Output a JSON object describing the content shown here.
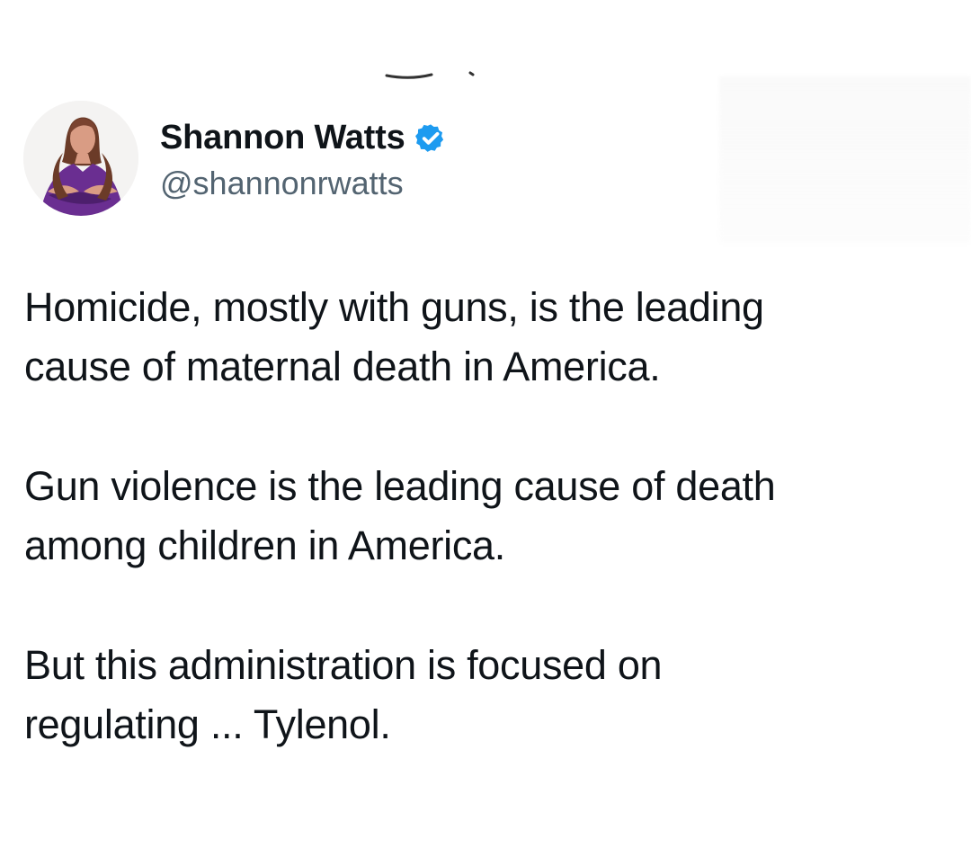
{
  "app": {
    "background_color": "#ffffff"
  },
  "tweet": {
    "author": {
      "name": "Shannon Watts",
      "handle": "@shannonrwatts",
      "verified": true,
      "avatar_icon": "profile-photo"
    },
    "paragraphs": [
      {
        "lines": [
          "Homicide, mostly with guns, is the leading",
          "cause of maternal death in America."
        ]
      },
      {
        "lines": [
          "Gun violence is the leading cause of death",
          "among children in America."
        ]
      },
      {
        "lines": [
          "But this administration is focused on",
          "regulating ... Tylenol."
        ]
      }
    ]
  },
  "colors": {
    "text": "#0f1419",
    "muted": "#536471",
    "verified": "#1d9bf0"
  }
}
